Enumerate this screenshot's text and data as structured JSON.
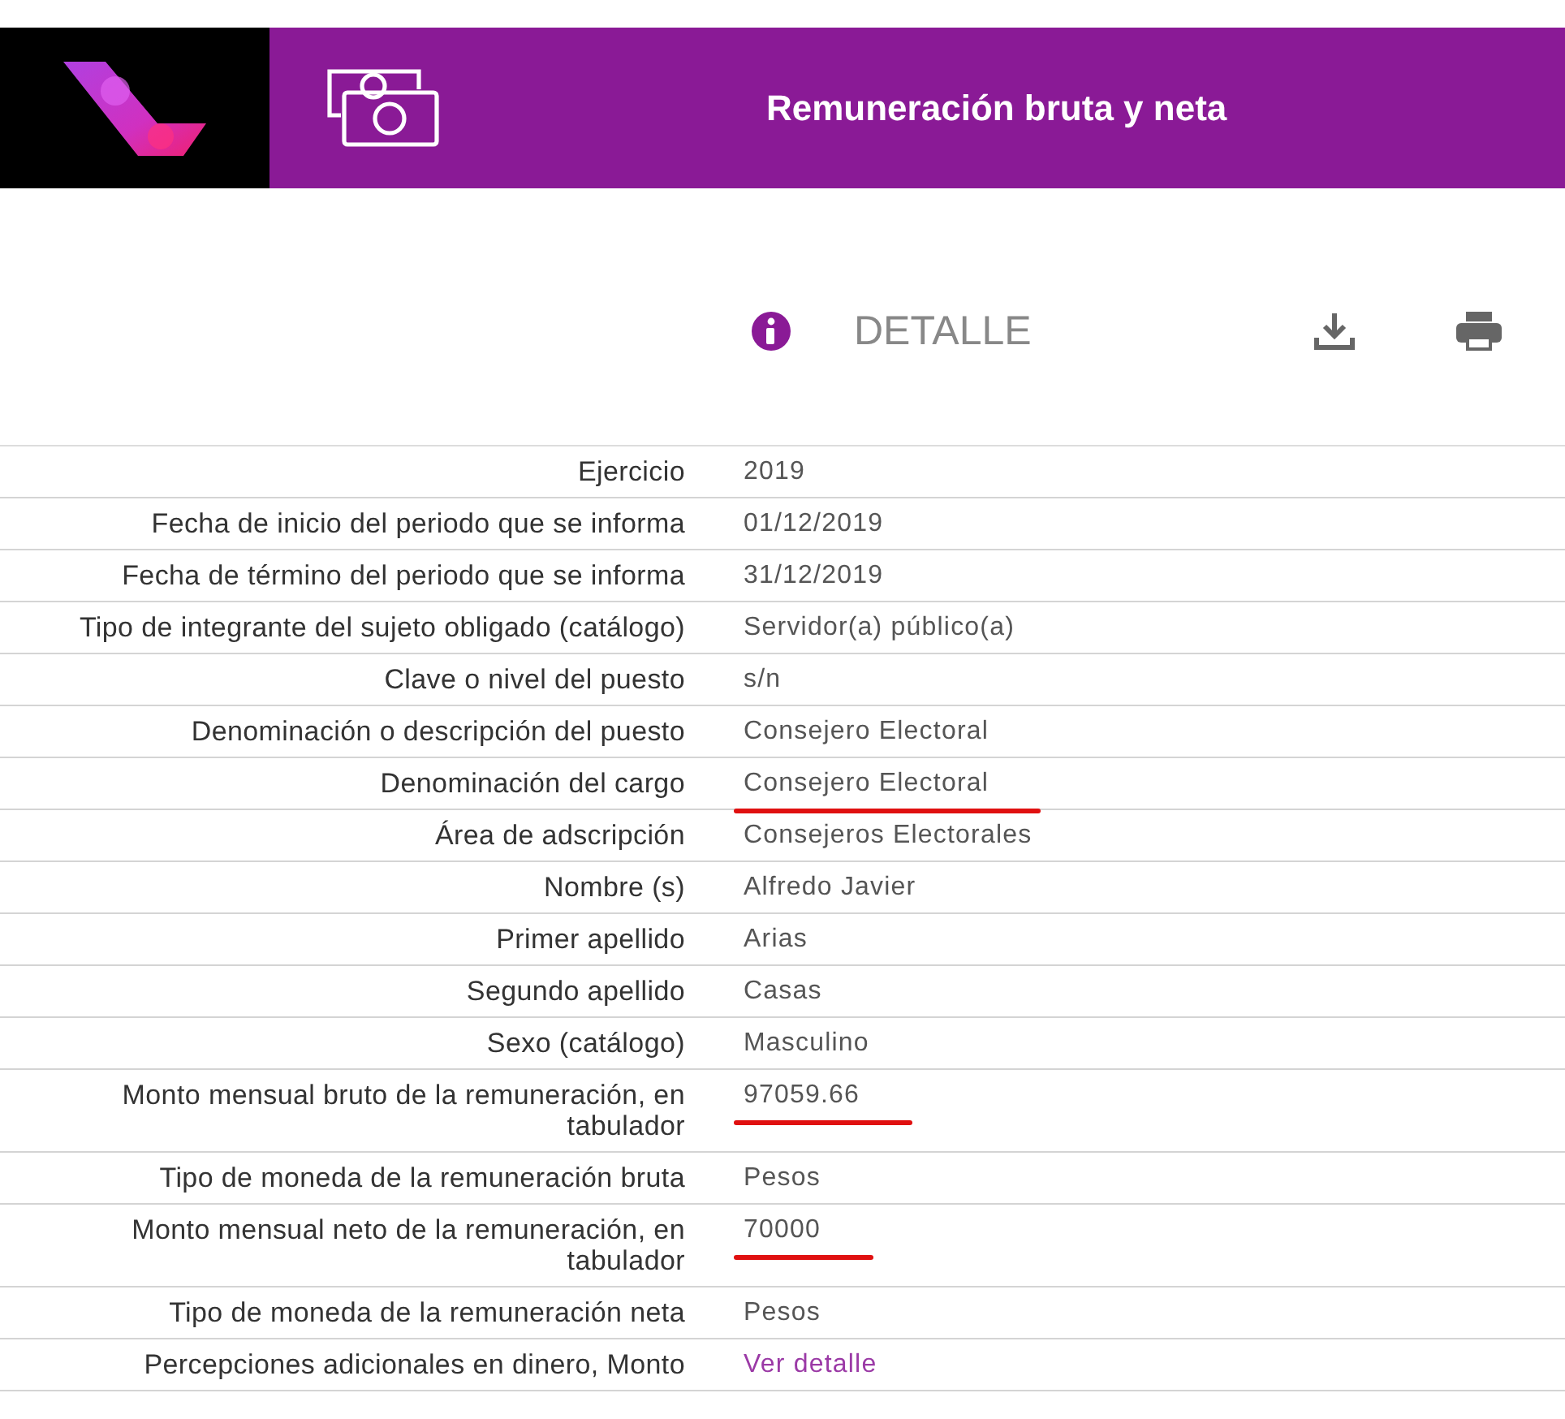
{
  "header": {
    "title": "Remuneración bruta y neta"
  },
  "detail": {
    "heading": "DETALLE"
  },
  "rows": [
    {
      "label": "Ejercicio",
      "value": "2019",
      "kind": "text",
      "underlined": false
    },
    {
      "label": "Fecha de inicio del periodo que se informa",
      "value": "01/12/2019",
      "kind": "text",
      "underlined": false
    },
    {
      "label": "Fecha de término del periodo que se informa",
      "value": "31/12/2019",
      "kind": "text",
      "underlined": false
    },
    {
      "label": "Tipo de integrante del sujeto obligado (catálogo)",
      "value": "Servidor(a) público(a)",
      "kind": "text",
      "underlined": false
    },
    {
      "label": "Clave o nivel del puesto",
      "value": "s/n",
      "kind": "text",
      "underlined": false
    },
    {
      "label": "Denominación o descripción del puesto",
      "value": "Consejero Electoral",
      "kind": "text",
      "underlined": false
    },
    {
      "label": "Denominación del cargo",
      "value": "Consejero Electoral",
      "kind": "text",
      "underlined": true
    },
    {
      "label": "Área de adscripción",
      "value": "Consejeros Electorales",
      "kind": "text",
      "underlined": false
    },
    {
      "label": "Nombre (s)",
      "value": "Alfredo Javier",
      "kind": "text",
      "underlined": false
    },
    {
      "label": "Primer apellido",
      "value": "Arias",
      "kind": "text",
      "underlined": false
    },
    {
      "label": "Segundo apellido",
      "value": "Casas",
      "kind": "text",
      "underlined": false
    },
    {
      "label": "Sexo (catálogo)",
      "value": "Masculino",
      "kind": "text",
      "underlined": false
    },
    {
      "label": "Monto mensual bruto de la remuneración, en tabulador",
      "value": "97059.66",
      "kind": "text",
      "underlined": true
    },
    {
      "label": "Tipo de moneda de la remuneración bruta",
      "value": "Pesos",
      "kind": "text",
      "underlined": false
    },
    {
      "label": "Monto mensual neto de la remuneración, en tabulador",
      "value": "70000",
      "kind": "text",
      "underlined": true
    },
    {
      "label": "Tipo de moneda de la remuneración neta",
      "value": "Pesos",
      "kind": "text",
      "underlined": false
    },
    {
      "label": "Percepciones adicionales en dinero, Monto",
      "value": "Ver detalle",
      "kind": "link",
      "underlined": false
    }
  ]
}
